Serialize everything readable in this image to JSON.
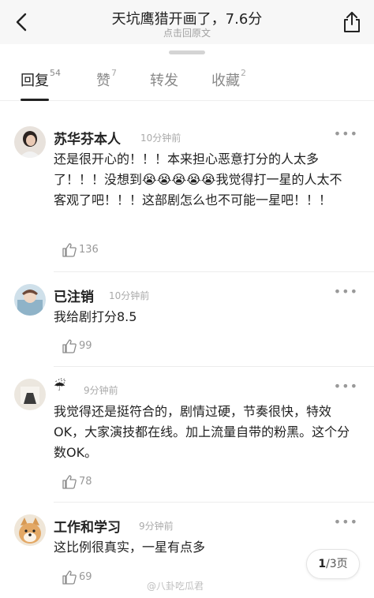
{
  "header": {
    "title": "天坑鹰猎开画了，7.6分",
    "subtitle": "点击回原文"
  },
  "tabs": [
    {
      "label": "回复",
      "count": "54"
    },
    {
      "label": "赞",
      "count": "7"
    },
    {
      "label": "转发",
      "count": ""
    },
    {
      "label": "收藏",
      "count": "2"
    }
  ],
  "comments": [
    {
      "name": "苏华芬本人",
      "time": "10分钟前",
      "text": "还是很开心的！！！本来担心恶意打分的人太多了！！！没想到😭😭😭😭😭我觉得打一星的人太不客观了吧！！！这部剧怎么也不可能一星吧！！！",
      "likes": "136"
    },
    {
      "name": "已注销",
      "time": "10分钟前",
      "text": "我给剧打分8.5",
      "likes": "99"
    },
    {
      "name": "☔",
      "time": "9分钟前",
      "text": "我觉得还是挺符合的，剧情过硬，节奏很快，特效OK，大家演技都在线。加上流量自带的粉黑。这个分数OK。",
      "likes": "78"
    },
    {
      "name": "工作和学习",
      "time": "9分钟前",
      "text": "这比例很真实，一星有点多",
      "likes": "69"
    }
  ],
  "pager": {
    "current": "1",
    "rest": "/3页"
  },
  "watermark": "@八卦吃瓜君",
  "colors": {
    "text": "#222222",
    "muted": "#999999",
    "divider": "#ececec"
  }
}
